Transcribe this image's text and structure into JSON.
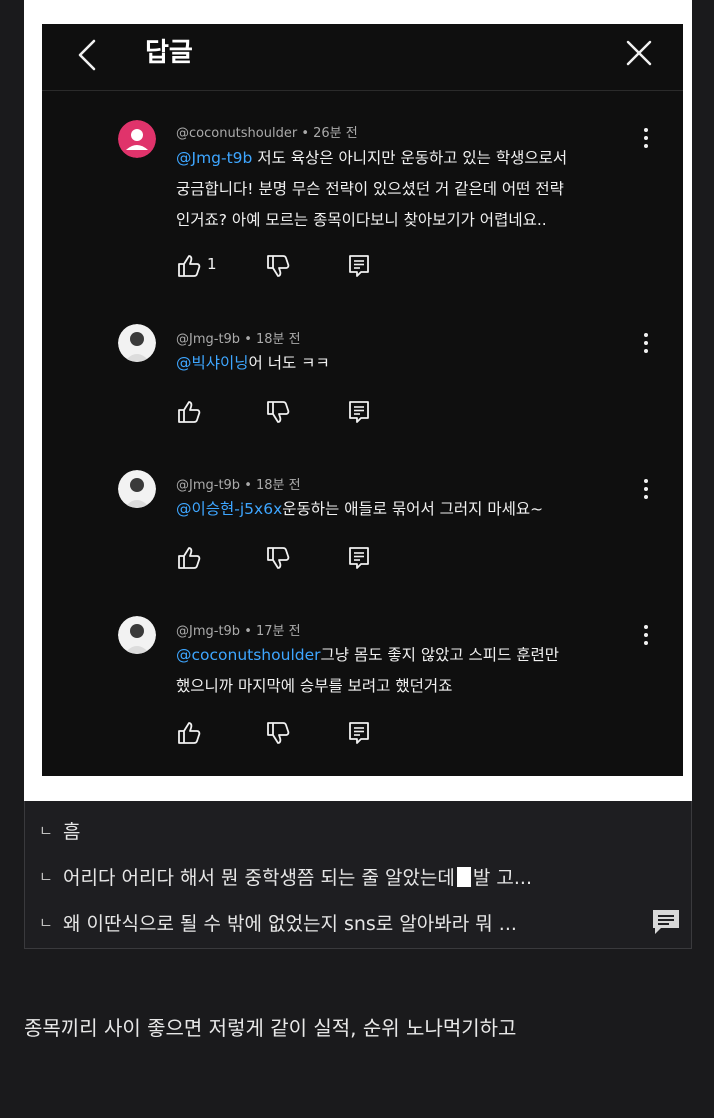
{
  "header": {
    "title": "답글"
  },
  "comments": [
    {
      "author": "@coconutshoulder",
      "time": "26분 전",
      "mention": "@Jmg-t9b",
      "body_first": " 저도 육상은 아니지만 운동하고 있는 학생으로서",
      "body_lines": [
        "궁금합니다! 분명 무슨 전략이 있으셨던 거 같은데 어떤 전략",
        "인거죠? 아예 모르는 종목이다보니 찾아보기가 어렵네요.."
      ],
      "likes": "1",
      "avatar_color": "#e0336b"
    },
    {
      "author": "@Jmg-t9b",
      "time": "18분 전",
      "mention": "@빅샤이닝",
      "body_first": "어 너도 ㅋㅋ",
      "body_lines": [],
      "likes": ""
    },
    {
      "author": "@Jmg-t9b",
      "time": "18분 전",
      "mention": "@이승현-j5x6x",
      "body_first": "운동하는 애들로 묶어서 그러지 마세요~",
      "body_lines": [],
      "likes": ""
    },
    {
      "author": "@Jmg-t9b",
      "time": "17분 전",
      "mention": "@coconutshoulder",
      "body_first": "그냥 몸도 좋지 않았고 스피드 훈련만",
      "body_lines": [
        "했으니까 마지막에 승부를 보려고 했던거죠"
      ],
      "likes": ""
    }
  ],
  "comment_tree": {
    "mark": "ㄴ",
    "line1": "흠",
    "line2_before": "어리다 어리다 해서 뭔 중학생쯤 되는 줄 알았는데",
    "line2_after": "발 고...",
    "line3": "왜 이딴식으로 될 수 밖에 없었는지 sns로 알아봐라 뭐 ..."
  },
  "caption": "종목끼리 사이 좋으면 저렇게 같이 실적, 순위 노나먹기하고",
  "icons": {
    "back": "back-arrow-icon",
    "close": "close-icon",
    "more": "kebab-icon",
    "like": "thumb-up-icon",
    "dislike": "thumb-down-icon",
    "reply": "reply-icon",
    "message": "message-icon"
  },
  "colors": {
    "mention": "#3ea6ff",
    "screen_bg": "#0f0f0f",
    "page_bg": "#1a1a1c"
  }
}
